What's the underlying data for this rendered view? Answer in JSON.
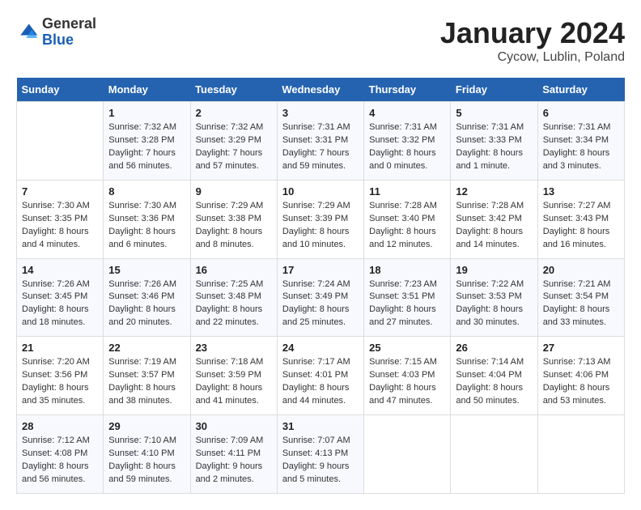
{
  "header": {
    "logo_general": "General",
    "logo_blue": "Blue",
    "month_title": "January 2024",
    "location": "Cycow, Lublin, Poland"
  },
  "days_of_week": [
    "Sunday",
    "Monday",
    "Tuesday",
    "Wednesday",
    "Thursday",
    "Friday",
    "Saturday"
  ],
  "weeks": [
    [
      {
        "day": "",
        "sunrise": "",
        "sunset": "",
        "daylight": ""
      },
      {
        "day": "1",
        "sunrise": "Sunrise: 7:32 AM",
        "sunset": "Sunset: 3:28 PM",
        "daylight": "Daylight: 7 hours and 56 minutes."
      },
      {
        "day": "2",
        "sunrise": "Sunrise: 7:32 AM",
        "sunset": "Sunset: 3:29 PM",
        "daylight": "Daylight: 7 hours and 57 minutes."
      },
      {
        "day": "3",
        "sunrise": "Sunrise: 7:31 AM",
        "sunset": "Sunset: 3:31 PM",
        "daylight": "Daylight: 7 hours and 59 minutes."
      },
      {
        "day": "4",
        "sunrise": "Sunrise: 7:31 AM",
        "sunset": "Sunset: 3:32 PM",
        "daylight": "Daylight: 8 hours and 0 minutes."
      },
      {
        "day": "5",
        "sunrise": "Sunrise: 7:31 AM",
        "sunset": "Sunset: 3:33 PM",
        "daylight": "Daylight: 8 hours and 1 minute."
      },
      {
        "day": "6",
        "sunrise": "Sunrise: 7:31 AM",
        "sunset": "Sunset: 3:34 PM",
        "daylight": "Daylight: 8 hours and 3 minutes."
      }
    ],
    [
      {
        "day": "7",
        "sunrise": "Sunrise: 7:30 AM",
        "sunset": "Sunset: 3:35 PM",
        "daylight": "Daylight: 8 hours and 4 minutes."
      },
      {
        "day": "8",
        "sunrise": "Sunrise: 7:30 AM",
        "sunset": "Sunset: 3:36 PM",
        "daylight": "Daylight: 8 hours and 6 minutes."
      },
      {
        "day": "9",
        "sunrise": "Sunrise: 7:29 AM",
        "sunset": "Sunset: 3:38 PM",
        "daylight": "Daylight: 8 hours and 8 minutes."
      },
      {
        "day": "10",
        "sunrise": "Sunrise: 7:29 AM",
        "sunset": "Sunset: 3:39 PM",
        "daylight": "Daylight: 8 hours and 10 minutes."
      },
      {
        "day": "11",
        "sunrise": "Sunrise: 7:28 AM",
        "sunset": "Sunset: 3:40 PM",
        "daylight": "Daylight: 8 hours and 12 minutes."
      },
      {
        "day": "12",
        "sunrise": "Sunrise: 7:28 AM",
        "sunset": "Sunset: 3:42 PM",
        "daylight": "Daylight: 8 hours and 14 minutes."
      },
      {
        "day": "13",
        "sunrise": "Sunrise: 7:27 AM",
        "sunset": "Sunset: 3:43 PM",
        "daylight": "Daylight: 8 hours and 16 minutes."
      }
    ],
    [
      {
        "day": "14",
        "sunrise": "Sunrise: 7:26 AM",
        "sunset": "Sunset: 3:45 PM",
        "daylight": "Daylight: 8 hours and 18 minutes."
      },
      {
        "day": "15",
        "sunrise": "Sunrise: 7:26 AM",
        "sunset": "Sunset: 3:46 PM",
        "daylight": "Daylight: 8 hours and 20 minutes."
      },
      {
        "day": "16",
        "sunrise": "Sunrise: 7:25 AM",
        "sunset": "Sunset: 3:48 PM",
        "daylight": "Daylight: 8 hours and 22 minutes."
      },
      {
        "day": "17",
        "sunrise": "Sunrise: 7:24 AM",
        "sunset": "Sunset: 3:49 PM",
        "daylight": "Daylight: 8 hours and 25 minutes."
      },
      {
        "day": "18",
        "sunrise": "Sunrise: 7:23 AM",
        "sunset": "Sunset: 3:51 PM",
        "daylight": "Daylight: 8 hours and 27 minutes."
      },
      {
        "day": "19",
        "sunrise": "Sunrise: 7:22 AM",
        "sunset": "Sunset: 3:53 PM",
        "daylight": "Daylight: 8 hours and 30 minutes."
      },
      {
        "day": "20",
        "sunrise": "Sunrise: 7:21 AM",
        "sunset": "Sunset: 3:54 PM",
        "daylight": "Daylight: 8 hours and 33 minutes."
      }
    ],
    [
      {
        "day": "21",
        "sunrise": "Sunrise: 7:20 AM",
        "sunset": "Sunset: 3:56 PM",
        "daylight": "Daylight: 8 hours and 35 minutes."
      },
      {
        "day": "22",
        "sunrise": "Sunrise: 7:19 AM",
        "sunset": "Sunset: 3:57 PM",
        "daylight": "Daylight: 8 hours and 38 minutes."
      },
      {
        "day": "23",
        "sunrise": "Sunrise: 7:18 AM",
        "sunset": "Sunset: 3:59 PM",
        "daylight": "Daylight: 8 hours and 41 minutes."
      },
      {
        "day": "24",
        "sunrise": "Sunrise: 7:17 AM",
        "sunset": "Sunset: 4:01 PM",
        "daylight": "Daylight: 8 hours and 44 minutes."
      },
      {
        "day": "25",
        "sunrise": "Sunrise: 7:15 AM",
        "sunset": "Sunset: 4:03 PM",
        "daylight": "Daylight: 8 hours and 47 minutes."
      },
      {
        "day": "26",
        "sunrise": "Sunrise: 7:14 AM",
        "sunset": "Sunset: 4:04 PM",
        "daylight": "Daylight: 8 hours and 50 minutes."
      },
      {
        "day": "27",
        "sunrise": "Sunrise: 7:13 AM",
        "sunset": "Sunset: 4:06 PM",
        "daylight": "Daylight: 8 hours and 53 minutes."
      }
    ],
    [
      {
        "day": "28",
        "sunrise": "Sunrise: 7:12 AM",
        "sunset": "Sunset: 4:08 PM",
        "daylight": "Daylight: 8 hours and 56 minutes."
      },
      {
        "day": "29",
        "sunrise": "Sunrise: 7:10 AM",
        "sunset": "Sunset: 4:10 PM",
        "daylight": "Daylight: 8 hours and 59 minutes."
      },
      {
        "day": "30",
        "sunrise": "Sunrise: 7:09 AM",
        "sunset": "Sunset: 4:11 PM",
        "daylight": "Daylight: 9 hours and 2 minutes."
      },
      {
        "day": "31",
        "sunrise": "Sunrise: 7:07 AM",
        "sunset": "Sunset: 4:13 PM",
        "daylight": "Daylight: 9 hours and 5 minutes."
      },
      {
        "day": "",
        "sunrise": "",
        "sunset": "",
        "daylight": ""
      },
      {
        "day": "",
        "sunrise": "",
        "sunset": "",
        "daylight": ""
      },
      {
        "day": "",
        "sunrise": "",
        "sunset": "",
        "daylight": ""
      }
    ]
  ]
}
